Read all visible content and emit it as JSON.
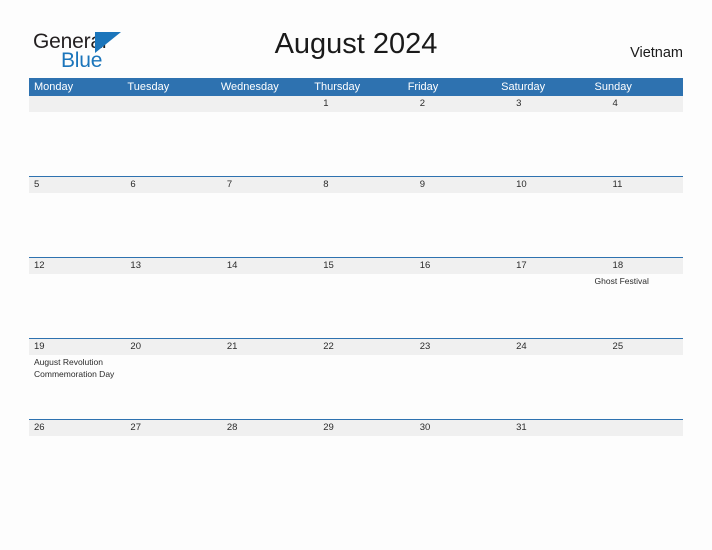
{
  "brand": {
    "name_part1": "General",
    "name_part2": "Blue",
    "flag_icon": "flag-icon",
    "colors": {
      "dark": "#231f20",
      "blue": "#1b75bb"
    }
  },
  "header": {
    "title": "August 2024",
    "region": "Vietnam"
  },
  "calendar": {
    "colors": {
      "header_blue": "#2e72b0",
      "band_gray": "#f0f0f0",
      "page_background": "#fdfdfd",
      "text": "#2b2b2b"
    },
    "day_headers": [
      "Monday",
      "Tuesday",
      "Wednesday",
      "Thursday",
      "Friday",
      "Saturday",
      "Sunday"
    ],
    "weeks": [
      {
        "days": [
          {
            "number": ""
          },
          {
            "number": ""
          },
          {
            "number": ""
          },
          {
            "number": "1",
            "events": []
          },
          {
            "number": "2",
            "events": []
          },
          {
            "number": "3",
            "events": []
          },
          {
            "number": "4",
            "events": []
          }
        ]
      },
      {
        "days": [
          {
            "number": "5",
            "events": []
          },
          {
            "number": "6",
            "events": []
          },
          {
            "number": "7",
            "events": []
          },
          {
            "number": "8",
            "events": []
          },
          {
            "number": "9",
            "events": []
          },
          {
            "number": "10",
            "events": []
          },
          {
            "number": "11",
            "events": []
          }
        ]
      },
      {
        "days": [
          {
            "number": "12",
            "events": []
          },
          {
            "number": "13",
            "events": []
          },
          {
            "number": "14",
            "events": []
          },
          {
            "number": "15",
            "events": []
          },
          {
            "number": "16",
            "events": []
          },
          {
            "number": "17",
            "events": []
          },
          {
            "number": "18",
            "events": [
              "Ghost Festival"
            ]
          }
        ]
      },
      {
        "days": [
          {
            "number": "19",
            "events": [
              "August Revolution Commemoration Day"
            ]
          },
          {
            "number": "20",
            "events": []
          },
          {
            "number": "21",
            "events": []
          },
          {
            "number": "22",
            "events": []
          },
          {
            "number": "23",
            "events": []
          },
          {
            "number": "24",
            "events": []
          },
          {
            "number": "25",
            "events": []
          }
        ]
      },
      {
        "days": [
          {
            "number": "26",
            "events": []
          },
          {
            "number": "27",
            "events": []
          },
          {
            "number": "28",
            "events": []
          },
          {
            "number": "29",
            "events": []
          },
          {
            "number": "30",
            "events": []
          },
          {
            "number": "31",
            "events": []
          },
          {
            "number": "",
            "events": []
          }
        ]
      }
    ]
  }
}
